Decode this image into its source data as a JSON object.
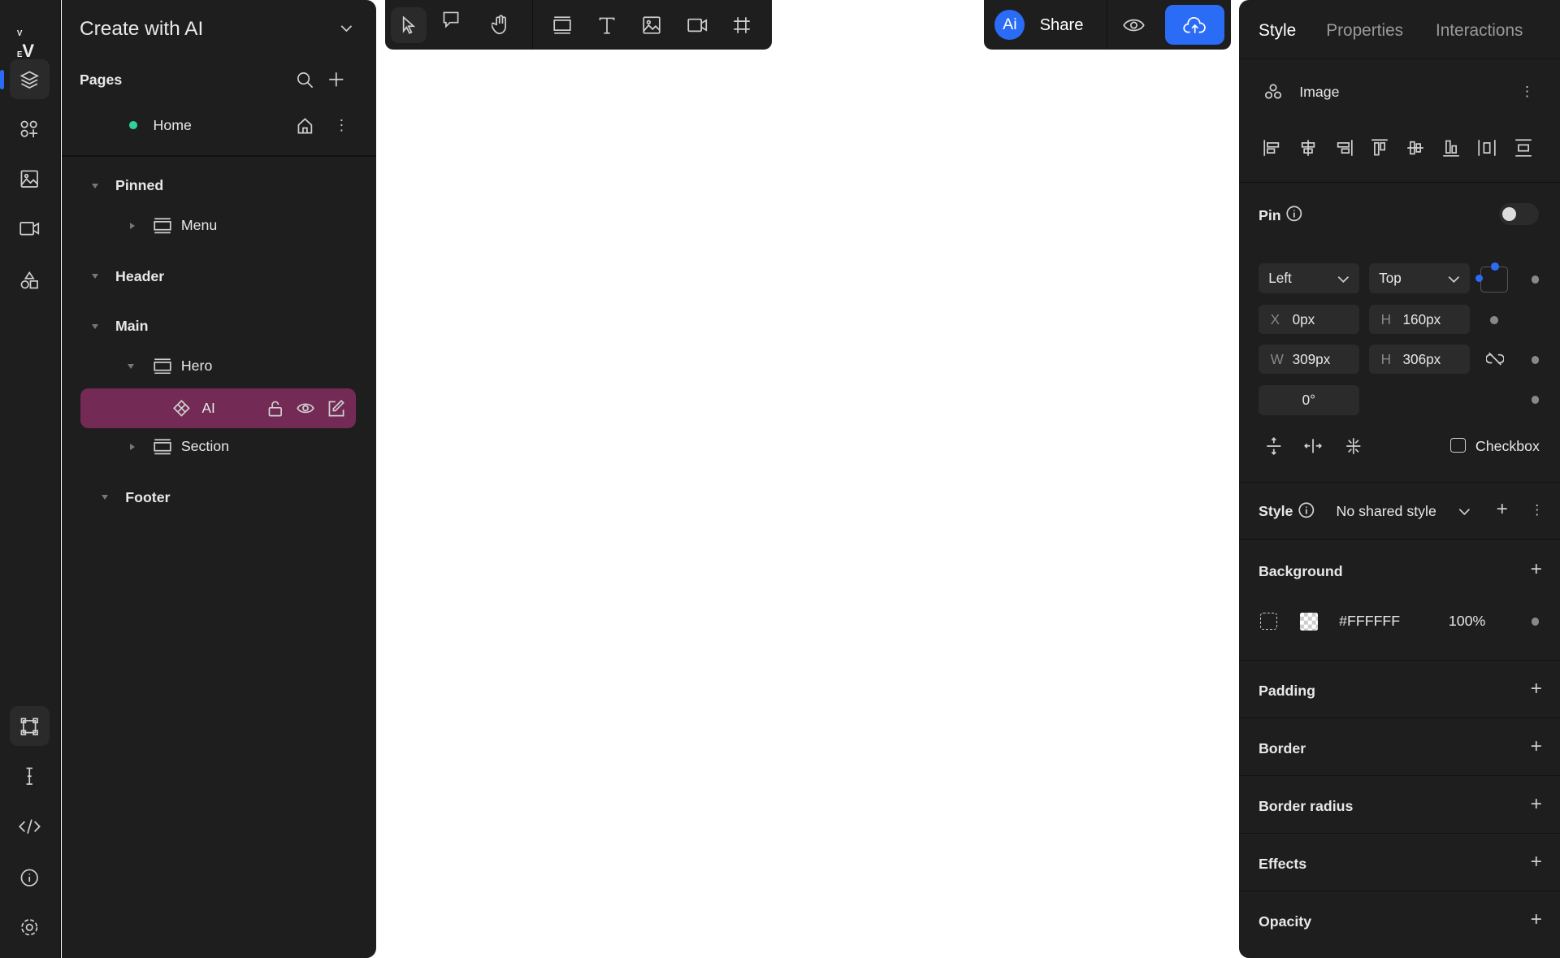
{
  "left_panel": {
    "title": "Create with AI",
    "pages_label": "Pages",
    "home_page": "Home",
    "tree": [
      {
        "label": "Pinned"
      },
      {
        "label": "Menu"
      },
      {
        "label": "Header"
      },
      {
        "label": "Main"
      },
      {
        "label": "Hero"
      },
      {
        "label": "AI"
      },
      {
        "label": "Section"
      },
      {
        "label": "Footer"
      }
    ]
  },
  "topbar": {
    "ai_badge": "Ai",
    "share_label": "Share"
  },
  "right_panel": {
    "tabs": [
      "Style",
      "Properties",
      "Interactions"
    ],
    "element_type": "Image",
    "pin_label": "Pin",
    "pin_enabled": false,
    "anchor_h": "Left",
    "anchor_v": "Top",
    "x_label": "X",
    "x_value": "0px",
    "y_label": "H",
    "y_value": "160px",
    "w_label": "W",
    "w_value": "309px",
    "h_label": "H",
    "h_value": "306px",
    "rotation": "0°",
    "checkbox_label": "Checkbox",
    "style_label": "Style",
    "shared_style": "No shared style",
    "background_label": "Background",
    "bg_color": "#FFFFFF",
    "bg_opacity": "100%",
    "sections": [
      "Padding",
      "Border",
      "Border radius",
      "Effects",
      "Opacity"
    ]
  },
  "colors": {
    "accent": "#2b6cf6",
    "selected_layer": "#732a55",
    "page_dot": "#2fd39a"
  }
}
